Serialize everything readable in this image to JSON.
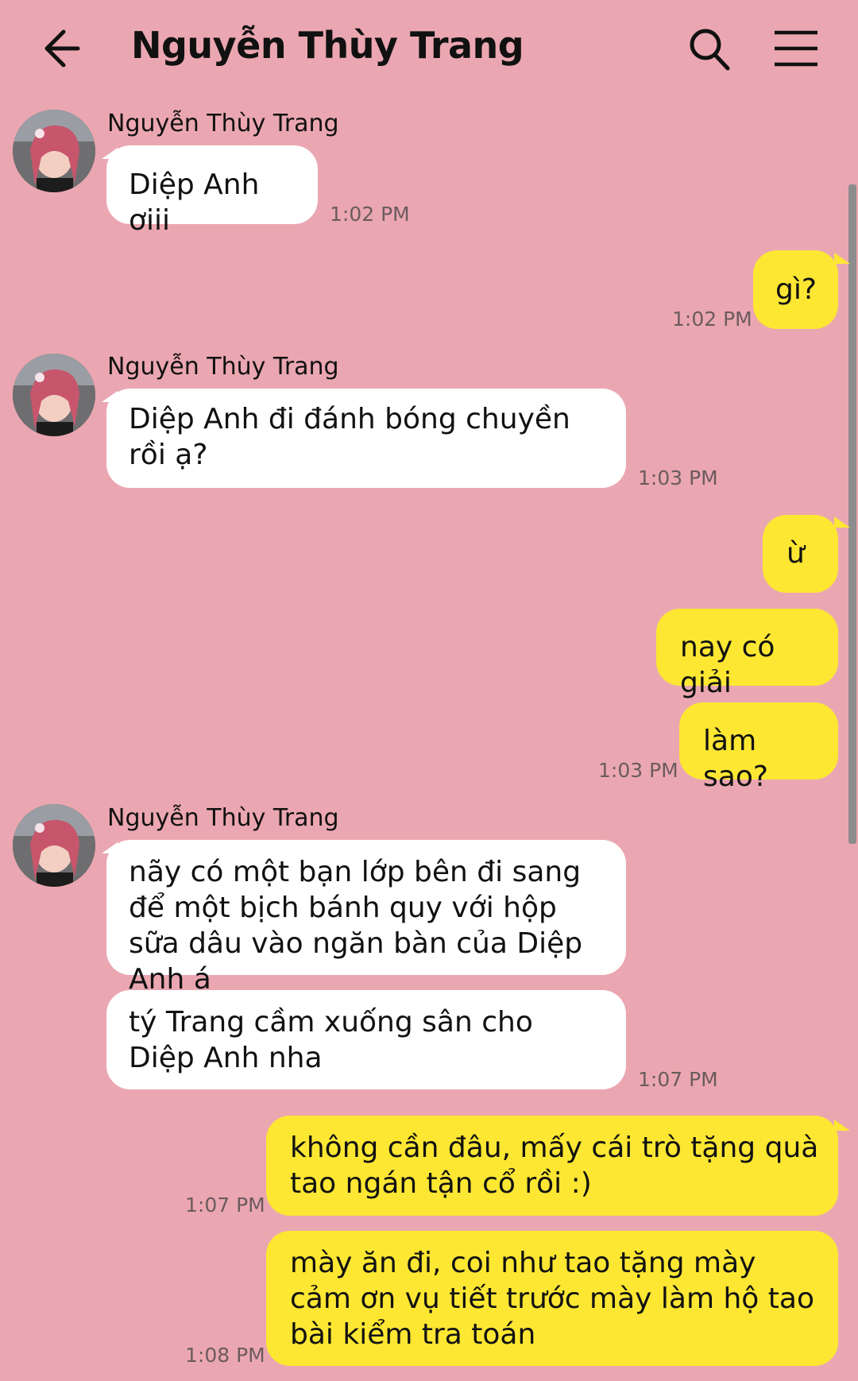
{
  "header": {
    "title": "Nguyễn Thùy Trang",
    "back_icon": "arrow-left-icon",
    "search_icon": "search-icon",
    "menu_icon": "hamburger-menu-icon"
  },
  "colors": {
    "background": "#eba7b1",
    "incoming_bubble": "#ffffff",
    "outgoing_bubble": "#fde733",
    "timestamp": "#6b5b5e"
  },
  "messages": [
    {
      "sender": "Nguyễn Thùy Trang",
      "text": "Diệp Anh ơiii",
      "time": "1:02 PM",
      "direction": "in"
    },
    {
      "text": "gì?",
      "time": "1:02 PM",
      "direction": "out"
    },
    {
      "sender": "Nguyễn Thùy Trang",
      "text": "Diệp Anh đi đánh bóng chuyền rồi ạ?",
      "time": "1:03 PM",
      "direction": "in"
    },
    {
      "text": "ừ",
      "direction": "out"
    },
    {
      "text": "nay có giải",
      "direction": "out"
    },
    {
      "text": "làm sao?",
      "time": "1:03 PM",
      "direction": "out"
    },
    {
      "sender": "Nguyễn Thùy Trang",
      "text": "nãy có một bạn lớp bên đi sang để một bịch bánh quy với hộp sữa dâu vào ngăn bàn của Diệp Anh á",
      "direction": "in"
    },
    {
      "text": "tý Trang cầm xuống sân cho Diệp Anh nha",
      "time": "1:07 PM",
      "direction": "in"
    },
    {
      "text": "không cần đâu, mấy cái trò tặng quà tao ngán tận cổ rồi :)",
      "time": "1:07 PM",
      "direction": "out"
    },
    {
      "text": "mày ăn đi, coi như tao tặng mày cảm ơn vụ tiết trước mày làm hộ tao bài kiểm tra toán",
      "time": "1:08 PM",
      "direction": "out"
    }
  ]
}
